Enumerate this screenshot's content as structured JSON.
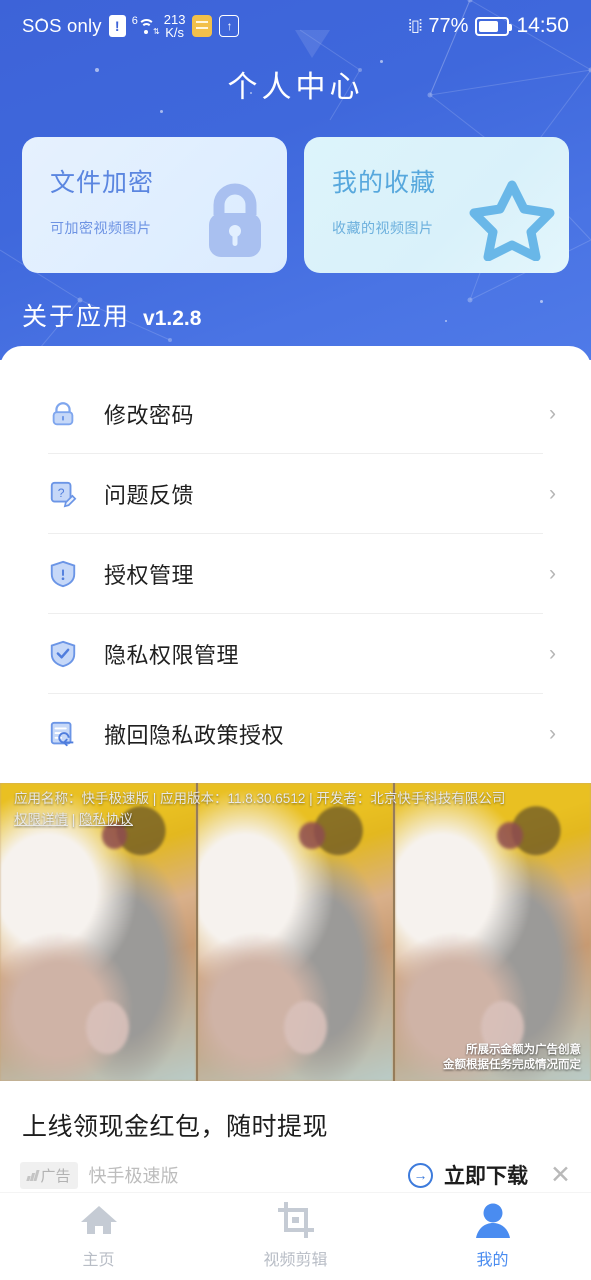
{
  "status_bar": {
    "carrier": "SOS only",
    "wifi_gen": "6",
    "net_speed_value": "213",
    "net_speed_unit": "K/s",
    "battery_percent": "77%",
    "clock": "14:50",
    "icons": [
      "alert-icon",
      "wifi-icon",
      "sim-icon",
      "upload-icon",
      "vibrate-icon",
      "battery-icon"
    ]
  },
  "header": {
    "title": "个人中心"
  },
  "cards": [
    {
      "title": "文件加密",
      "subtitle": "可加密视频图片",
      "icon": "lock-icon",
      "accent": "#5b86e0",
      "background": "#e2efff"
    },
    {
      "title": "我的收藏",
      "subtitle": "收藏的视频图片",
      "icon": "star-icon",
      "accent": "#57a8dd",
      "background": "#daf2fb"
    }
  ],
  "about": {
    "label": "关于应用",
    "version": "v1.2.8"
  },
  "menu": {
    "items": [
      {
        "label": "修改密码",
        "icon": "lock-icon",
        "chevron": "›"
      },
      {
        "label": "问题反馈",
        "icon": "feedback-edit-icon",
        "chevron": "›"
      },
      {
        "label": "授权管理",
        "icon": "shield-exclamation-icon",
        "chevron": "›"
      },
      {
        "label": "隐私权限管理",
        "icon": "shield-check-icon",
        "chevron": "›"
      },
      {
        "label": "撤回隐私政策授权",
        "icon": "document-revoke-icon",
        "chevron": "›"
      }
    ]
  },
  "ad": {
    "disclosure_line1": "应用名称：快手极速版 | 应用版本：11.8.30.6512 | 开发者：北京快手科技有限公司",
    "disclosure_link1": "权限详情",
    "disclosure_sep": " | ",
    "disclosure_link2": "隐私协议",
    "watermark_line1": "所展示金额为广告创意",
    "watermark_line2": "金额根据任务完成情况而定",
    "title": "上线领现金红包，随时提现",
    "tag": "广告",
    "brand": "快手极速版",
    "cta_label": "立即下载",
    "cta_icon": "arrow-right-circle-icon",
    "close_icon": "close-icon",
    "cta_color": "#3d7bdc"
  },
  "tabbar": {
    "items": [
      {
        "label": "主页",
        "icon": "home-icon",
        "active": false
      },
      {
        "label": "视频剪辑",
        "icon": "crop-icon",
        "active": false
      },
      {
        "label": "我的",
        "icon": "person-icon",
        "active": true
      }
    ],
    "active_color": "#4a8cf0",
    "inactive_color": "#b8bdc6"
  }
}
